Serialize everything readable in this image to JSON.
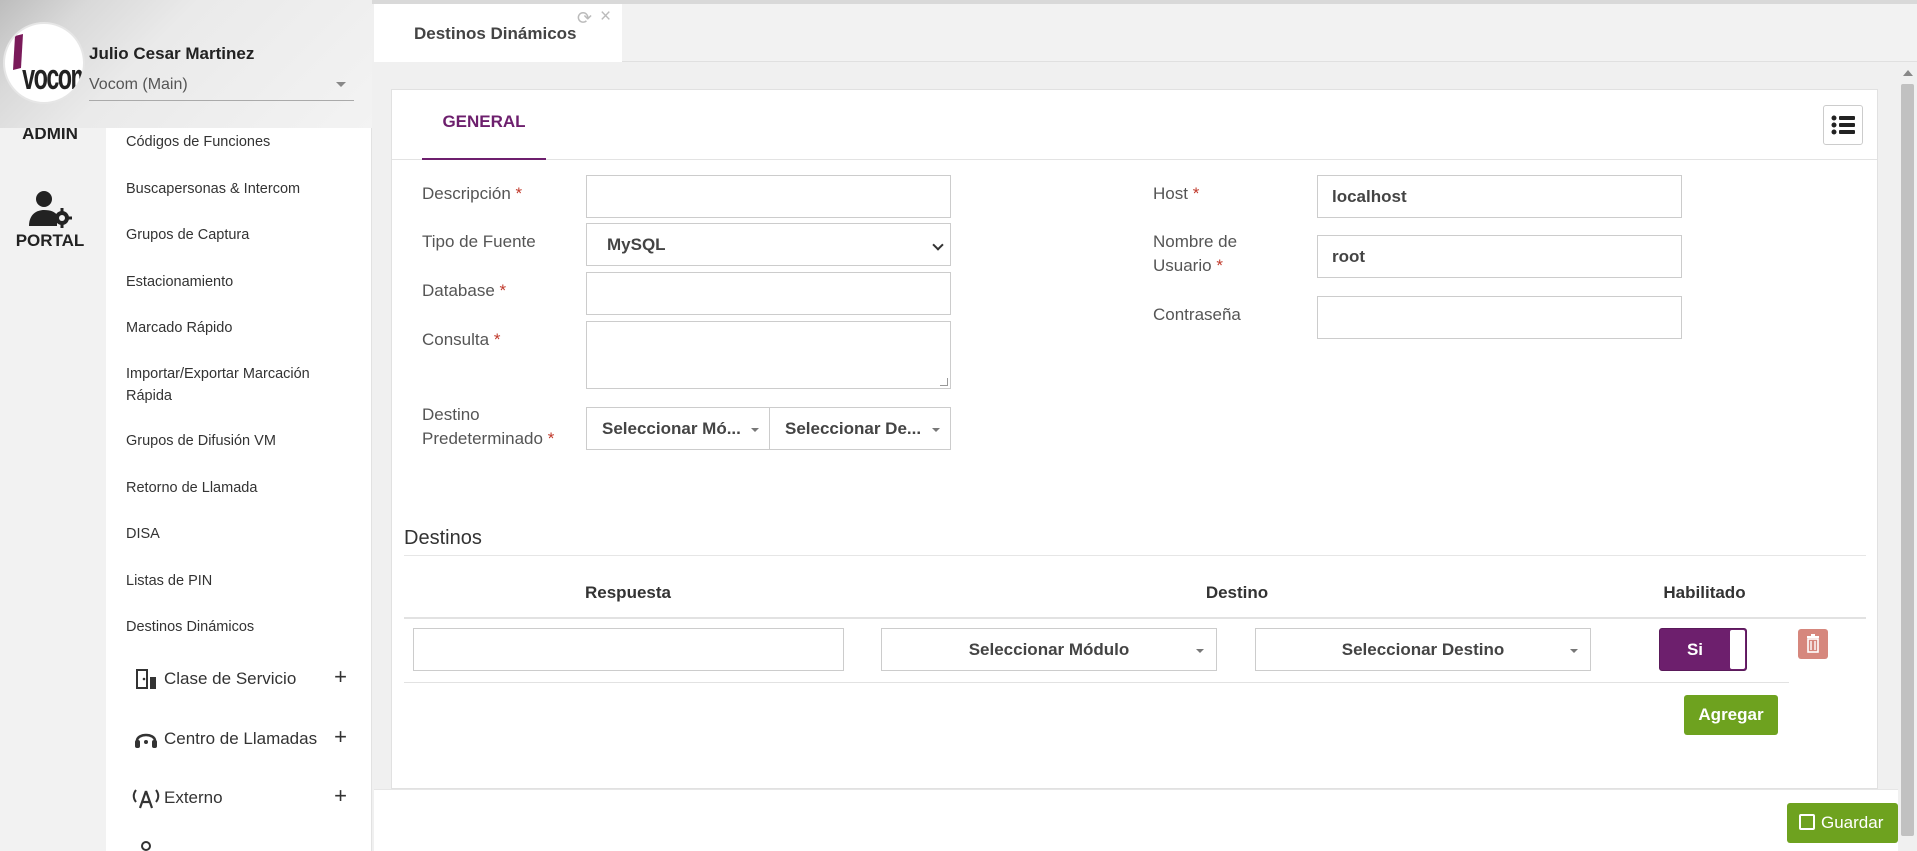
{
  "user": {
    "name": "Julio Cesar Martinez",
    "company": "Vocom (Main)"
  },
  "rail": {
    "admin_label": "ADMIN",
    "portal_label": "PORTAL"
  },
  "submenu": {
    "links": [
      "Códigos de Funciones",
      "Buscapersonas & Intercom",
      "Grupos de Captura",
      "Estacionamiento",
      "Marcado Rápido",
      "Importar/Exportar Marcación Rápida",
      "Grupos de Difusión VM",
      "Retorno de Llamada",
      "DISA",
      "Listas de PIN",
      "Destinos Dinámicos"
    ],
    "groups": [
      "Clase de Servicio",
      "Centro de Llamadas",
      "Externo"
    ]
  },
  "tab": {
    "title": "Destinos Dinámicos"
  },
  "form": {
    "tab_general": "GENERAL",
    "descripcion_label": "Descripción",
    "tipo_fuente_label": "Tipo de Fuente",
    "tipo_fuente_value": "MySQL",
    "database_label": "Database",
    "consulta_label": "Consulta",
    "destino_label_1": "Destino",
    "destino_label_2": "Predeterminado",
    "destino_modulo": "Seleccionar Mó...",
    "destino_destino": "Seleccionar De...",
    "host_label": "Host",
    "host_value": "localhost",
    "usuario_label_1": "Nombre de",
    "usuario_label_2": "Usuario",
    "usuario_value": "root",
    "password_label": "Contraseña",
    "required_mark": "*"
  },
  "destinos": {
    "title": "Destinos",
    "headers": {
      "respuesta": "Respuesta",
      "destino": "Destino",
      "habilitado": "Habilitado"
    },
    "row": {
      "modulo": "Seleccionar Módulo",
      "destino": "Seleccionar Destino",
      "habilitado": "Si"
    },
    "add_label": "Agregar"
  },
  "footer": {
    "save_label": "Guardar"
  },
  "colors": {
    "accent": "#6d1f6d",
    "success": "#6ea21f",
    "danger": "#d6877d",
    "required": "#c0392b"
  }
}
